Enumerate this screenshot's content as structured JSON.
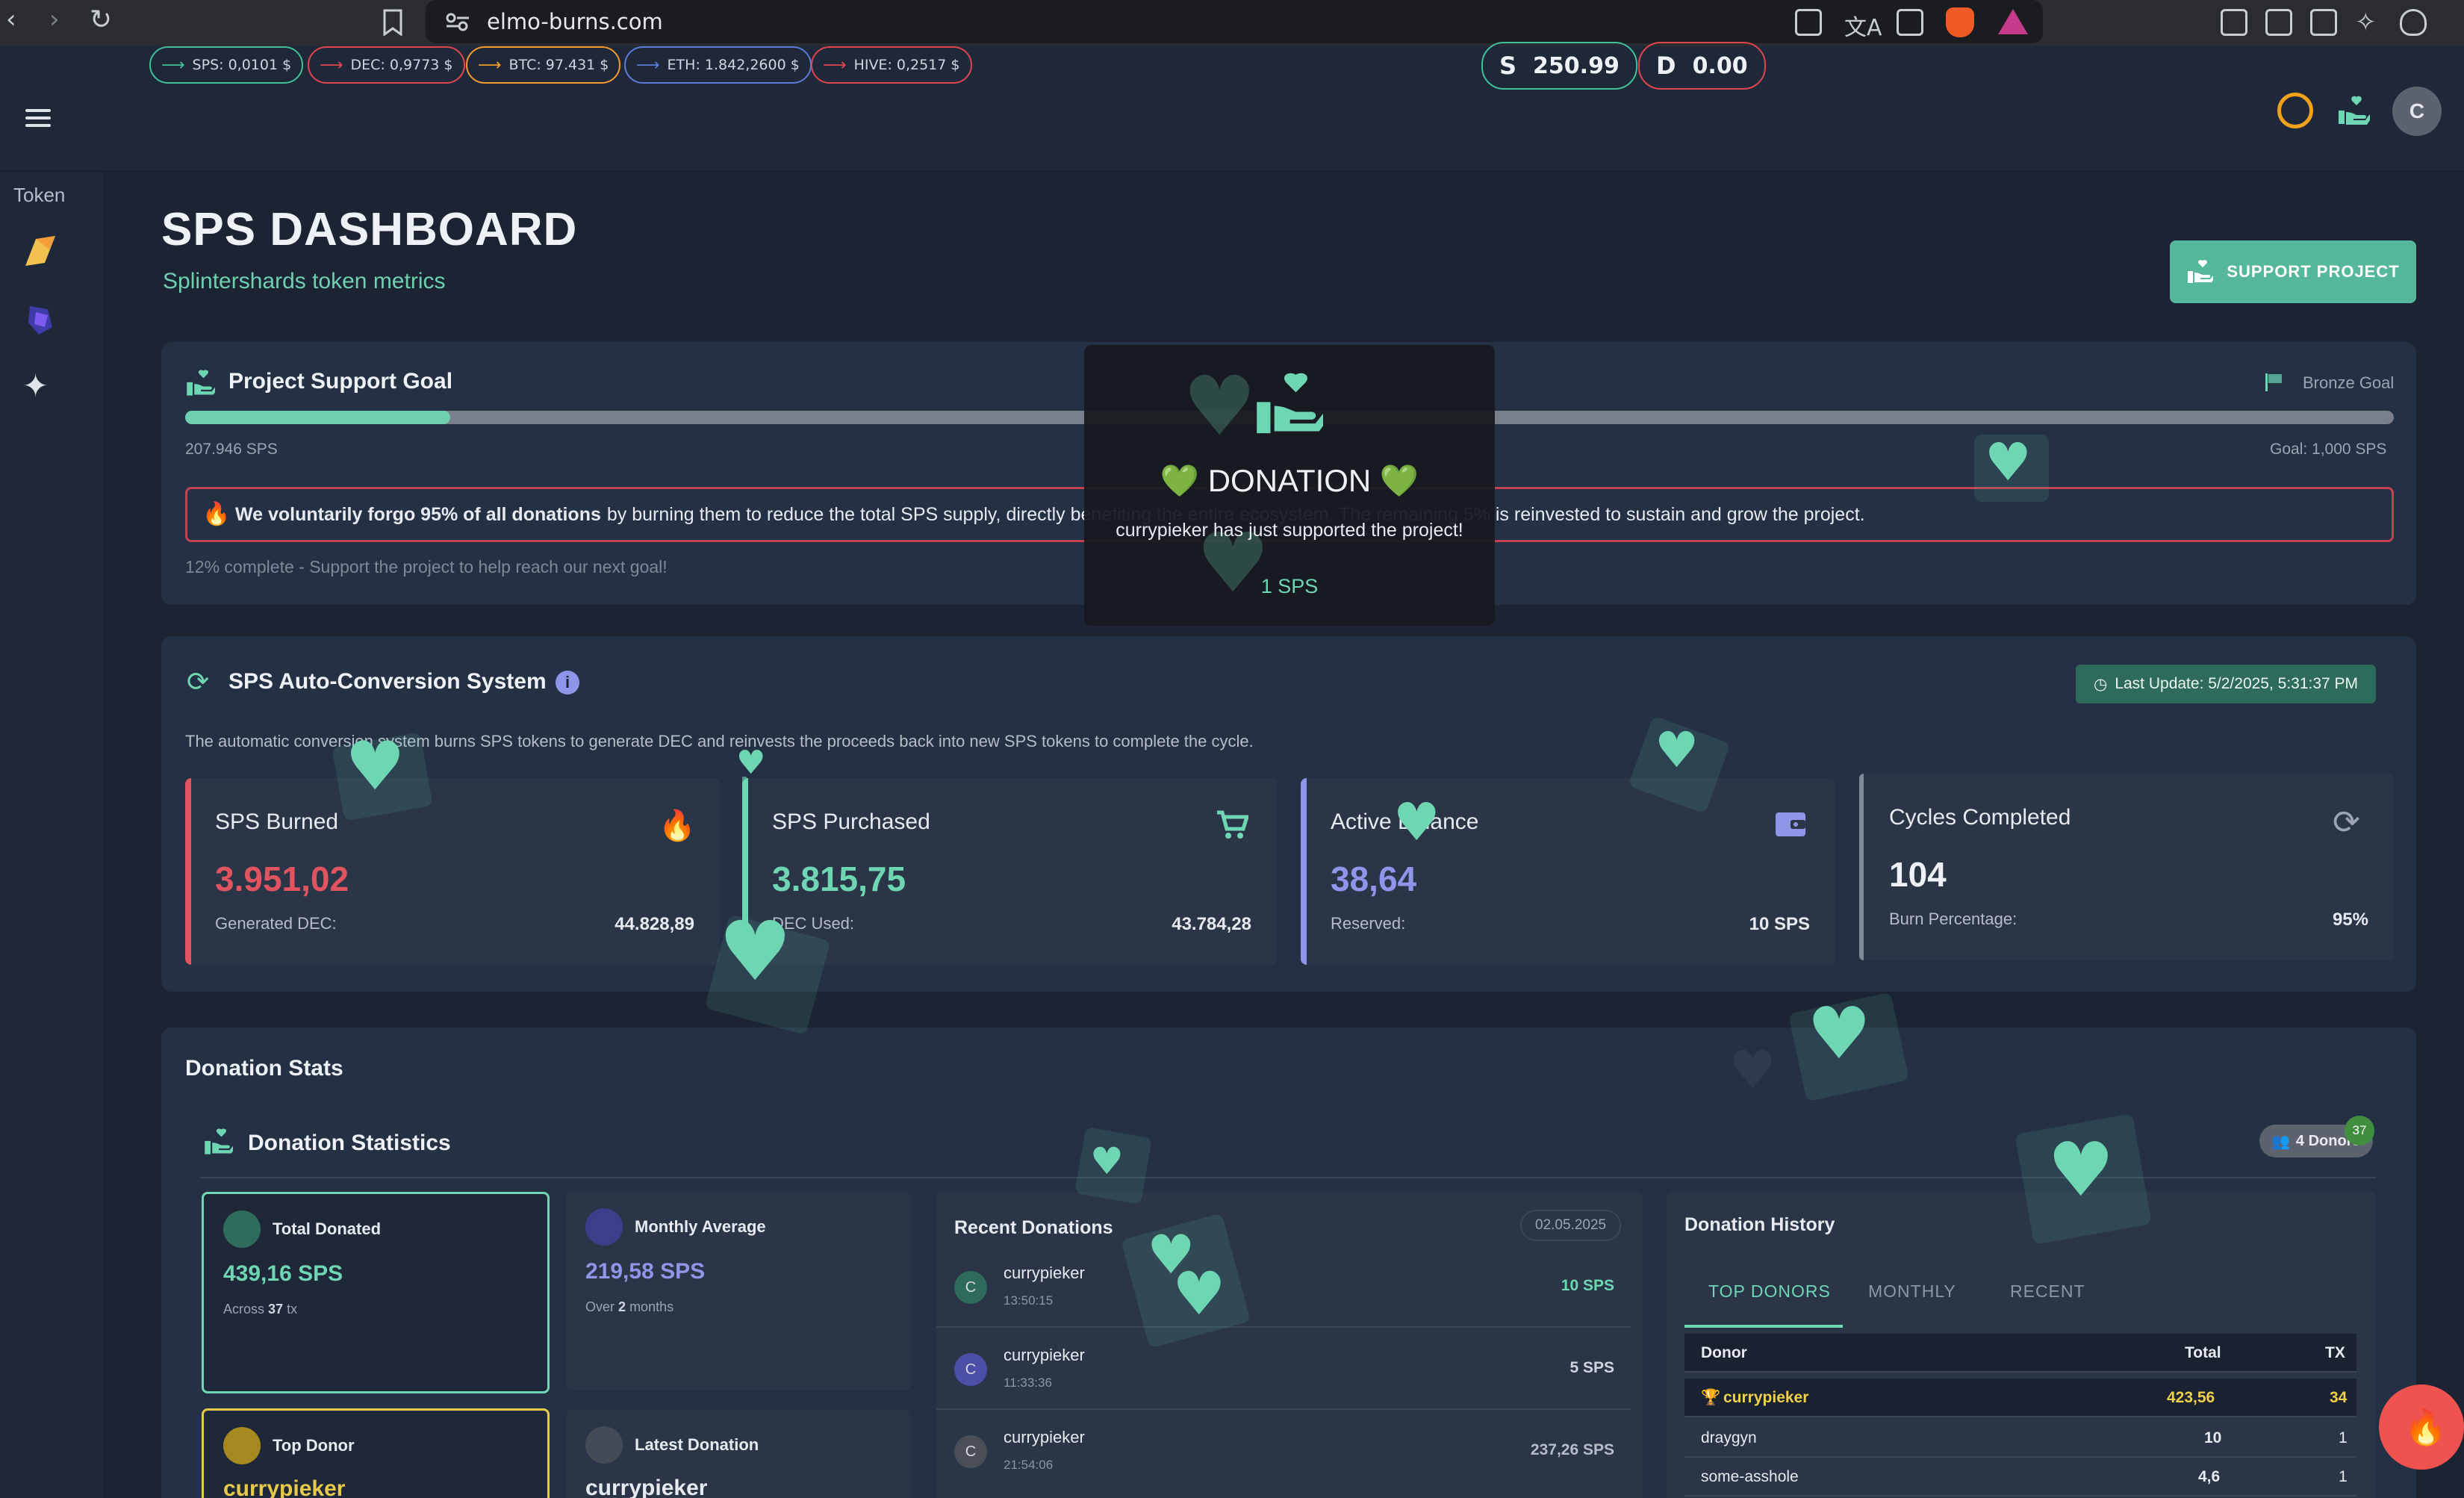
{
  "browser": {
    "url": "elmo-burns.com"
  },
  "topbar": {
    "tickers": [
      {
        "label": "SPS: 0,0101 $",
        "color": "#3fbf9a"
      },
      {
        "label": "DEC: 0,9773 $",
        "color": "#e0454f"
      },
      {
        "label": "BTC: 97.431 $",
        "color": "#f29a2e"
      },
      {
        "label": "ETH: 1.842,2600 $",
        "color": "#5b7bd6"
      },
      {
        "label": "HIVE: 0,2517 $",
        "color": "#e0454f"
      }
    ],
    "balance_s": {
      "symbol": "S",
      "value": "250.99"
    },
    "balance_d": {
      "symbol": "D",
      "value": "0.00"
    },
    "avatar_letter": "C"
  },
  "sidebar": {
    "label": "Token"
  },
  "header": {
    "title": "SPS DASHBOARD",
    "subtitle": "Splintershards token metrics",
    "support_button": "SUPPORT PROJECT"
  },
  "goal": {
    "title": "Project Support Goal",
    "badge": "Bronze Goal",
    "current": "207.946 SPS",
    "goal": "Goal: 1,000 SPS",
    "progress_fraction": 0.12,
    "notice_bold": "We voluntarily forgo 95% of all donations",
    "notice_rest": "by burning them to reduce the total SPS supply, directly benefiting the entire ecosystem. The remaining 5% is reinvested to sustain and grow the project.",
    "complete_text": "12% complete - Support the project to help reach our next goal!"
  },
  "popup": {
    "title": "💚 DONATION 💚",
    "message": "currypieker has just supported the project!",
    "amount": "1 SPS"
  },
  "conversion": {
    "title": "SPS Auto-Conversion System",
    "last_update": "Last Update: 5/2/2025, 5:31:37 PM",
    "description": "The automatic conversion system burns SPS tokens to generate DEC and reinvests the proceeds back into new SPS tokens to complete the cycle.",
    "stats": [
      {
        "name": "SPS Burned",
        "value": "3.951,02",
        "sub_label": "Generated DEC:",
        "sub_value": "44.828,89",
        "color": "#e0545f",
        "icon": "flame-icon"
      },
      {
        "name": "SPS Purchased",
        "value": "3.815,75",
        "sub_label": "DEC Used:",
        "sub_value": "43.784,28",
        "color": "#6fd6b4",
        "icon": "cart-icon"
      },
      {
        "name": "Active Balance",
        "value": "38,64",
        "sub_label": "Reserved:",
        "sub_value": "10 SPS",
        "color": "#8f95e8",
        "icon": "wallet-icon"
      },
      {
        "name": "Cycles Completed",
        "value": "104",
        "sub_label": "Burn Percentage:",
        "sub_value": "95%",
        "color": "#9aa4b4",
        "icon": "refresh-icon"
      }
    ]
  },
  "donations": {
    "section_title": "Donation Stats",
    "panel_title": "Donation Statistics",
    "donors_badge": "4 Donors",
    "donors_count": "37",
    "total": {
      "label": "Total Donated",
      "value": "439,16 SPS",
      "note_prefix": "Across",
      "note_count": "37",
      "note_suffix": "tx"
    },
    "monthly": {
      "label": "Monthly Average",
      "value": "219,58 SPS",
      "note_prefix": "Over",
      "note_count": "2",
      "note_suffix": "months"
    },
    "top_donor": {
      "label": "Top Donor",
      "value": "currypieker"
    },
    "latest": {
      "label": "Latest Donation",
      "value": "currypieker"
    },
    "recent": {
      "title": "Recent Donations",
      "date": "02.05.2025",
      "items": [
        {
          "initial": "C",
          "name": "currypieker",
          "time": "13:50:15",
          "amount": "10 SPS",
          "avatar_color": "#2f6b5a",
          "amount_color": "#6fd6b4"
        },
        {
          "initial": "C",
          "name": "currypieker",
          "time": "11:33:36",
          "amount": "5 SPS",
          "avatar_color": "#4c4fa8",
          "amount_color": "#cfd5de"
        },
        {
          "initial": "C",
          "name": "currypieker",
          "time": "21:54:06",
          "amount": "237,26 SPS",
          "avatar_color": "#4a4f57",
          "amount_color": "#b6bdc9"
        }
      ]
    },
    "history": {
      "title": "Donation History",
      "tabs": [
        "TOP DONORS",
        "MONTHLY",
        "RECENT"
      ],
      "columns": [
        "Donor",
        "Total",
        "TX"
      ],
      "rows": [
        {
          "donor": "currypieker",
          "total": "423,56",
          "tx": "34",
          "top": true
        },
        {
          "donor": "draygyn",
          "total": "10",
          "tx": "1",
          "top": false
        },
        {
          "donor": "some-asshole",
          "total": "4,6",
          "tx": "1",
          "top": false
        }
      ]
    }
  }
}
